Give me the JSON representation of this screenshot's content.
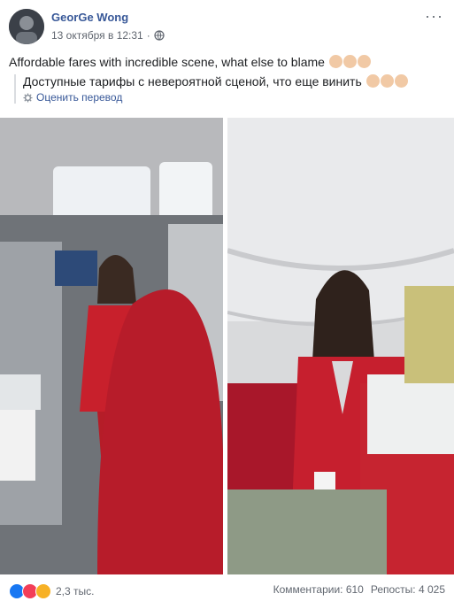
{
  "post": {
    "author": "GeorGe Wong",
    "timestamp": "13 октября в 12:31",
    "text": "Affordable fares with incredible scene, what else to blame",
    "translation_text": "Доступные тарифы с невероятной сценой, что еще винить",
    "rate_translation": "Оценить перевод"
  },
  "icons": {
    "privacy": "globe-icon",
    "more": "more-options-icon",
    "settings": "gear-icon",
    "emoji": "clapping-hands-emoji"
  },
  "footer": {
    "reaction_count": "2,3 тыс.",
    "comments": "Комментарии: 610",
    "shares": "Репосты: 4 025"
  },
  "colors": {
    "link": "#385898",
    "text": "#1c1e21",
    "meta": "#616770"
  }
}
